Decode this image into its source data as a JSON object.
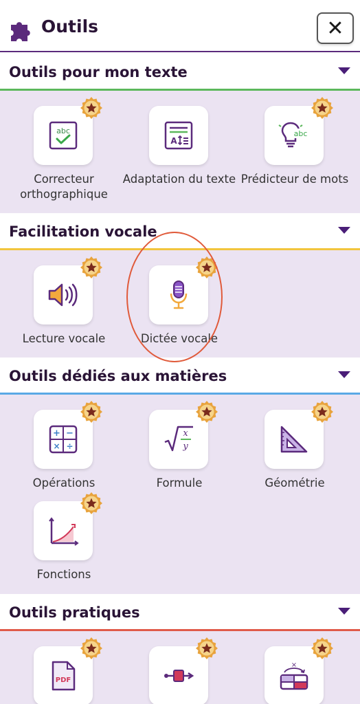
{
  "header": {
    "title": "Outils",
    "close_label": "✕"
  },
  "sections": [
    {
      "title": "Outils pour mon texte",
      "accent": "#5cb85c",
      "tools": [
        {
          "label": "Correcteur orthographique",
          "icon": "spellcheck-icon",
          "badge": true
        },
        {
          "label": "Adaptation du texte",
          "icon": "text-adapt-icon",
          "badge": false
        },
        {
          "label": "Prédicteur de mots",
          "icon": "word-predictor-icon",
          "badge": true
        }
      ]
    },
    {
      "title": "Facilitation vocale",
      "accent": "#f2c53d",
      "tools": [
        {
          "label": "Lecture vocale",
          "icon": "speaker-icon",
          "badge": true
        },
        {
          "label": "Dictée vocale",
          "icon": "microphone-icon",
          "badge": true
        }
      ]
    },
    {
      "title": "Outils dédiés aux matières",
      "accent": "#5aa9e6",
      "tools": [
        {
          "label": "Opérations",
          "icon": "calculator-icon",
          "badge": true
        },
        {
          "label": "Formule",
          "icon": "formula-icon",
          "badge": true
        },
        {
          "label": "Géométrie",
          "icon": "set-square-icon",
          "badge": true
        },
        {
          "label": "Fonctions",
          "icon": "function-graph-icon",
          "badge": true
        }
      ]
    },
    {
      "title": "Outils pratiques",
      "accent": "#e05a4a",
      "tools": [
        {
          "label": "",
          "icon": "pdf-icon",
          "badge": true
        },
        {
          "label": "",
          "icon": "slider-icon",
          "badge": true
        },
        {
          "label": "",
          "icon": "table-swap-icon",
          "badge": true
        }
      ]
    }
  ],
  "colors": {
    "purple": "#5b2a7c",
    "star_badge": "#e8a33d",
    "annotation": "#e05a3a"
  }
}
